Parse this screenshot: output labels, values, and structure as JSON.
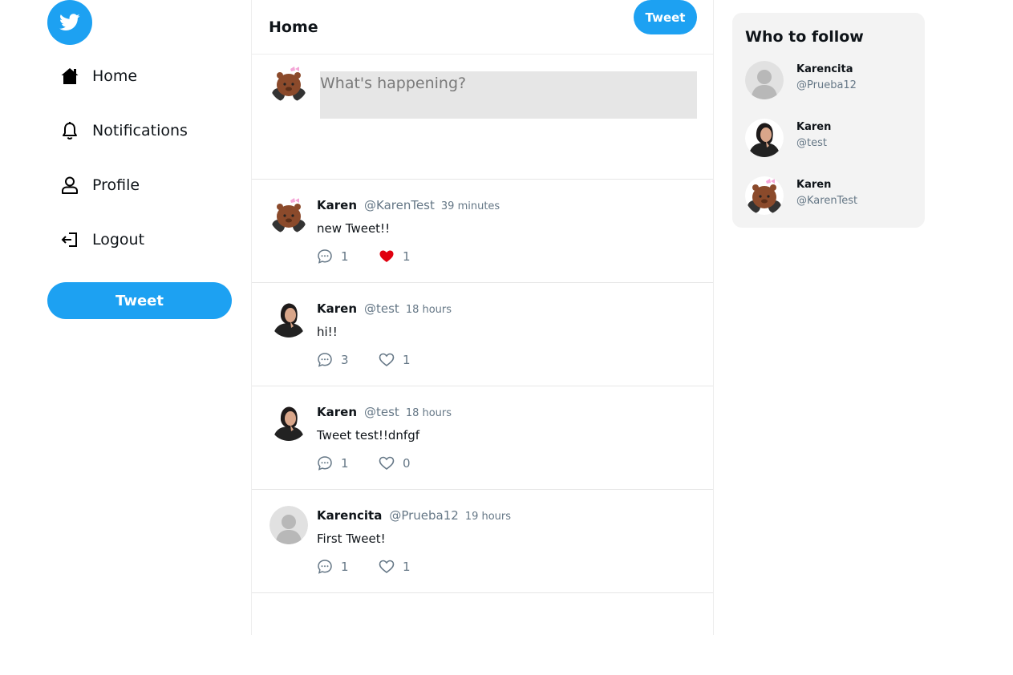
{
  "sidebar": {
    "logo_icon": "twitter-bird-icon",
    "nav": [
      {
        "label": "Home",
        "icon": "home-icon"
      },
      {
        "label": "Notifications",
        "icon": "bell-icon"
      },
      {
        "label": "Profile",
        "icon": "user-icon"
      },
      {
        "label": "Logout",
        "icon": "logout-icon"
      }
    ],
    "tweet_button": "Tweet"
  },
  "main": {
    "title": "Home",
    "composer": {
      "placeholder": "What's happening?",
      "button": "Tweet"
    },
    "tweets": [
      {
        "name": "Karen",
        "handle": "@KarenTest",
        "time": "39 minutes",
        "text": "new Tweet!!",
        "replies": "1",
        "likes": "1",
        "liked": true,
        "avatar": "bear-avatar"
      },
      {
        "name": "Karen",
        "handle": "@test",
        "time": "18 hours",
        "text": "hi!!",
        "replies": "3",
        "likes": "1",
        "liked": false,
        "avatar": "photo-avatar"
      },
      {
        "name": "Karen",
        "handle": "@test",
        "time": "18 hours",
        "text": "Tweet test!!dnfgf",
        "replies": "1",
        "likes": "0",
        "liked": false,
        "avatar": "photo-avatar"
      },
      {
        "name": "Karencita",
        "handle": "@Prueba12",
        "time": "19 hours",
        "text": "First Tweet!",
        "replies": "1",
        "likes": "1",
        "liked": false,
        "avatar": "default-avatar"
      }
    ]
  },
  "who_to_follow": {
    "title": "Who to follow",
    "users": [
      {
        "name": "Karencita",
        "handle": "@Prueba12",
        "avatar": "default-avatar"
      },
      {
        "name": "Karen",
        "handle": "@test",
        "avatar": "photo-avatar"
      },
      {
        "name": "Karen",
        "handle": "@KarenTest",
        "avatar": "bear-avatar"
      }
    ]
  },
  "colors": {
    "accent": "#1da1f2",
    "like_active": "#e0000f",
    "muted_text": "#657786",
    "input_bg": "#e6e6e6",
    "panel_bg": "#f3f3f3"
  }
}
